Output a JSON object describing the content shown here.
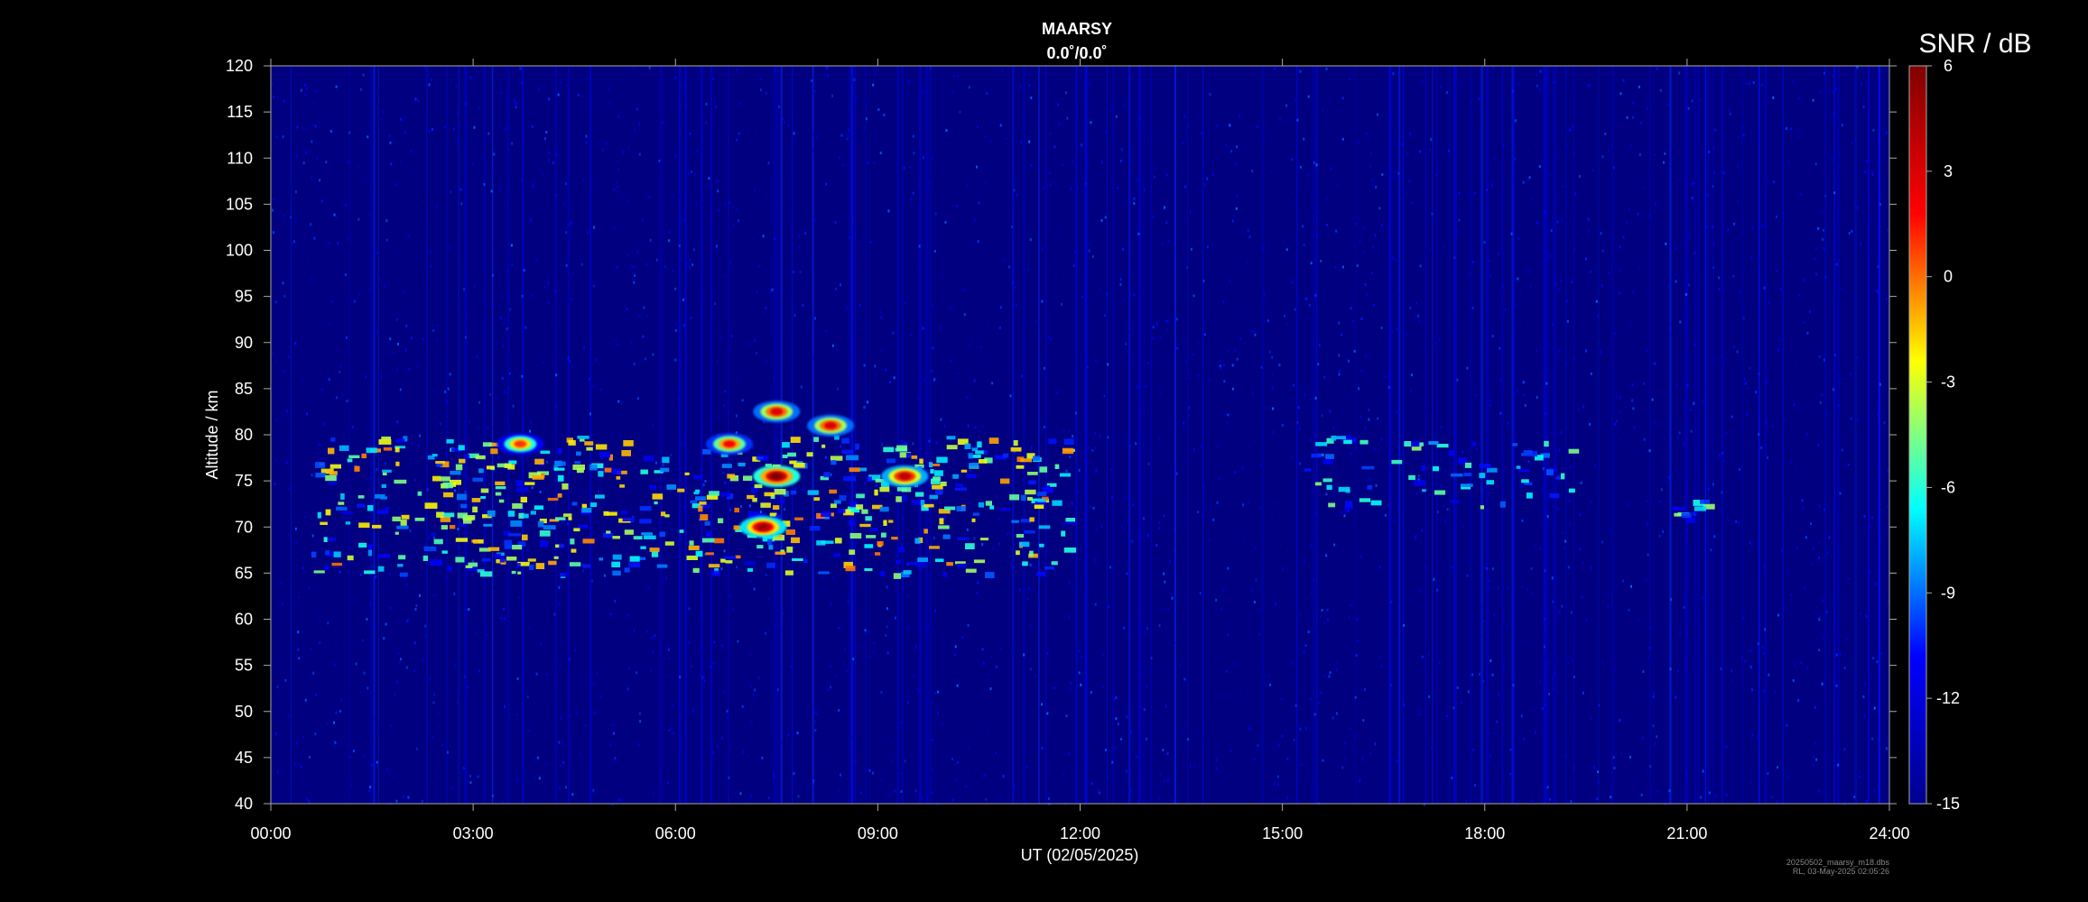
{
  "chart_data": {
    "type": "heatmap",
    "title": "MAARSY",
    "subtitle": "0.0˚/0.0˚",
    "xlabel": "UT (02/05/2025)",
    "ylabel": "Altitude / km",
    "colorbar_label": "SNR / dB",
    "x_ticks": [
      "00:00",
      "03:00",
      "06:00",
      "09:00",
      "12:00",
      "15:00",
      "18:00",
      "21:00",
      "24:00"
    ],
    "x_range_hours": [
      0,
      24
    ],
    "y_ticks": [
      40,
      45,
      50,
      55,
      60,
      65,
      70,
      75,
      80,
      85,
      90,
      95,
      100,
      105,
      110,
      115,
      120
    ],
    "y_range_km": [
      40,
      120
    ],
    "colorbar_ticks": [
      6,
      3,
      0,
      -3,
      -6,
      -9,
      -12,
      -15
    ],
    "clim_db": [
      -15,
      6
    ],
    "colormap": [
      "#00008f",
      "#0000ff",
      "#00ffff",
      "#ffff00",
      "#ff0000",
      "#800000"
    ],
    "background_db": -13.5,
    "echo_regions": [
      {
        "t_start": 0.6,
        "t_end": 11.8,
        "alt_min": 65,
        "alt_max": 80,
        "description": "main PMSE layer"
      },
      {
        "t_start": 15.3,
        "t_end": 19.3,
        "alt_min": 72,
        "alt_max": 80,
        "description": "weak afternoon echoes"
      },
      {
        "t_start": 20.7,
        "t_end": 21.3,
        "alt_min": 71,
        "alt_max": 73,
        "description": "evening echo patch"
      }
    ],
    "strong_echoes": [
      {
        "t": 7.5,
        "alt": 75.5,
        "snr_db": 6
      },
      {
        "t": 7.3,
        "alt": 70.0,
        "snr_db": 5
      },
      {
        "t": 9.4,
        "alt": 75.5,
        "snr_db": 4
      },
      {
        "t": 7.5,
        "alt": 82.5,
        "snr_db": 3
      },
      {
        "t": 8.3,
        "alt": 81.0,
        "snr_db": 3
      },
      {
        "t": 6.8,
        "alt": 79.0,
        "snr_db": 2
      },
      {
        "t": 3.7,
        "alt": 79.0,
        "snr_db": 1
      }
    ],
    "grid": false
  },
  "footer": {
    "file": "20250502_maarsy_m18.dbs",
    "stamp": "RL, 03-May-2025 02:05:26"
  }
}
